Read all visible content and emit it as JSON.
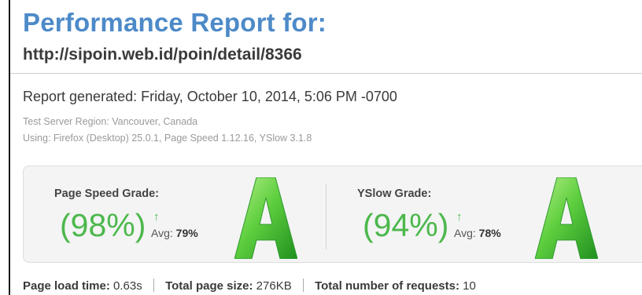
{
  "header": {
    "title": "Performance Report for:",
    "url": "http://sipoin.web.id/poin/detail/8366"
  },
  "report": {
    "generated": "Report generated: Friday, October 10, 2014, 5:06 PM -0700",
    "region": "Test Server Region: Vancouver, Canada",
    "using": "Using: Firefox (Desktop) 25.0.1, Page Speed 1.12.16, YSlow 3.1.8"
  },
  "grades": {
    "pagespeed": {
      "label": "Page Speed Grade:",
      "percent": "(98%)",
      "avg_label": "Avg:",
      "avg_value": "79%",
      "letter": "A",
      "trend_icon": "arrow-up-icon"
    },
    "yslow": {
      "label": "YSlow Grade:",
      "percent": "(94%)",
      "avg_label": "Avg:",
      "avg_value": "78%",
      "letter": "A",
      "trend_icon": "arrow-up-icon"
    }
  },
  "stats": {
    "load_time_label": "Page load time:",
    "load_time_value": "0.63s",
    "page_size_label": "Total page size:",
    "page_size_value": "276KB",
    "requests_label": "Total number of requests:",
    "requests_value": "10"
  },
  "colors": {
    "title": "#4d8ac8",
    "grade_green": "#4cb84c"
  }
}
